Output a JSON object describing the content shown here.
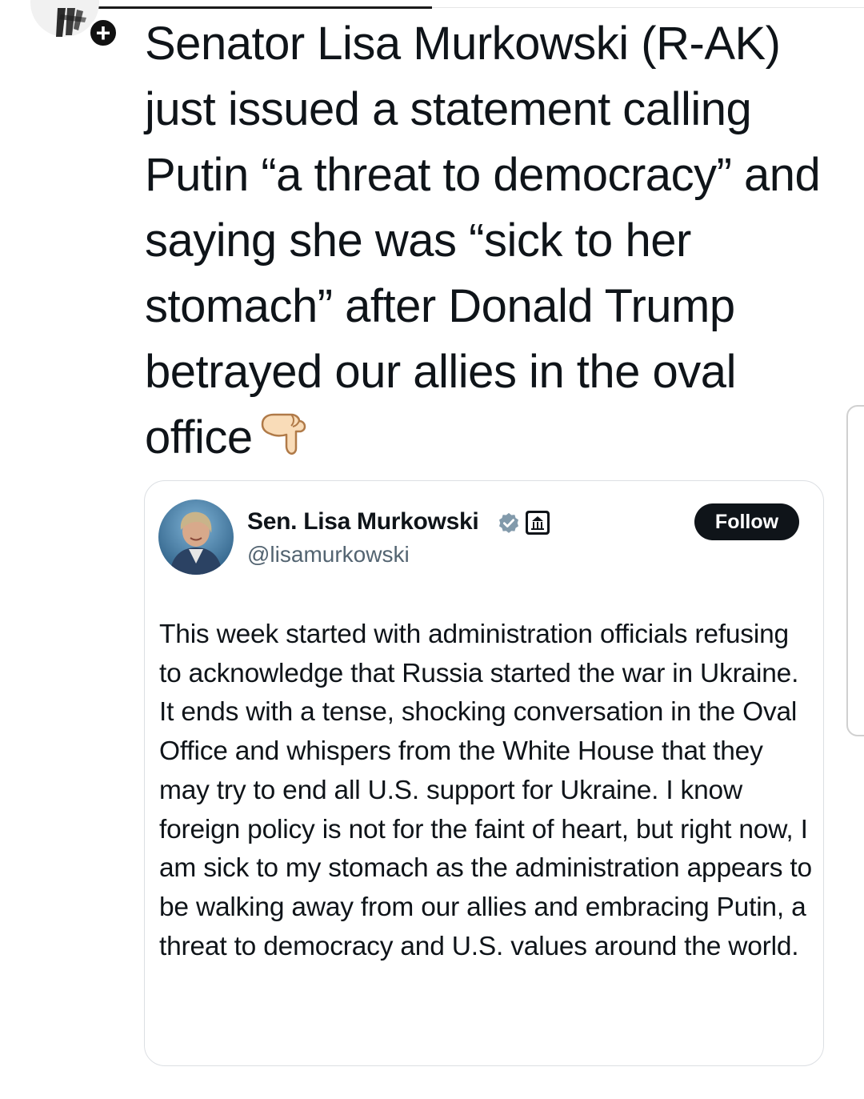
{
  "post": {
    "text": "Senator Lisa Murkowski (R-AK) just issued a statement calling Putin “a threat to democracy” and saying she was “sick to her stomach” after Donald Trump betrayed our allies in the oval office",
    "emoji_icon": "backhand-index-pointing-down-icon"
  },
  "quoted_tweet": {
    "author_name": "Sen. Lisa Murkowski",
    "handle": "@lisamurkowski",
    "follow_label": "Follow",
    "badges": [
      "verified-icon",
      "government-building-icon"
    ],
    "body": "This week started with administration officials refusing to acknowledge that Russia started the war in Ukraine. It ends with a tense, shocking conversation in the Oval Office and whispers from the White House that they may try to end all U.S. support for Ukraine. I know foreign policy is not for the faint of heart, but right now, I am sick to my stomach as the administration appears to be walking away from our allies and embracing Putin, a threat to democracy and U.S. values around the world."
  },
  "colors": {
    "text_primary": "#0f1419",
    "text_secondary": "#536471",
    "verified_badge": "#829aab",
    "card_border": "#dcdfe3",
    "follow_button": "#0f1419"
  }
}
